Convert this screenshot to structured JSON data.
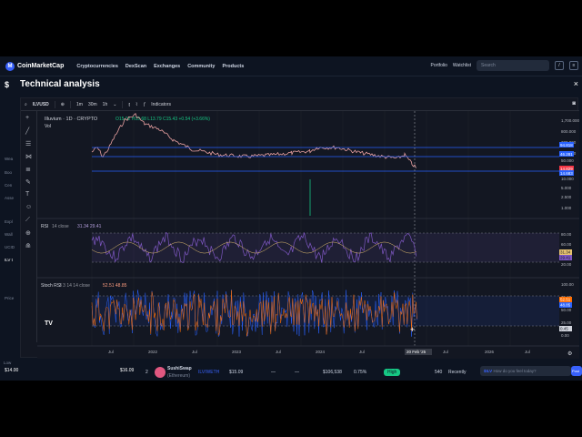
{
  "nav": {
    "brand": "CoinMarketCap",
    "links": [
      "Cryptocurrencies",
      "DexScan",
      "Exchanges",
      "Community",
      "Products"
    ],
    "portfolio": "Portfolio",
    "watchlist": "Watchlist",
    "search_placeholder": "Search",
    "slash_key": "/"
  },
  "left_fragments": {
    "dollar": "$",
    "items": [
      "Wea",
      "Boo",
      "Cen",
      "Asse",
      "Expl",
      "Wall",
      "UCID",
      "ILV t",
      "Price"
    ],
    "low_label": "Low",
    "low_value": "$14.00",
    "high_value": "$16.09"
  },
  "modal": {
    "title": "Technical analysis",
    "close": "×"
  },
  "toolbar": {
    "symbol": "ILVUSD",
    "intervals": [
      "1m",
      "30m",
      "1h"
    ],
    "indicators": "Indicators"
  },
  "legend": {
    "title": "Illuvium · 1D · CRYPTO",
    "ohlc": "O15.02 H15.68 L13.79 C15.43 +0.54 (+3.66%)",
    "vol": "Vol"
  },
  "rsi": {
    "label": "RSI",
    "params": "14 close",
    "values": "31.34 29.41"
  },
  "stoch": {
    "label": "Stoch RSI",
    "params": "3 3 14 14 close",
    "values": "52.51 48.85"
  },
  "price_axis": [
    "1,700.000",
    "800.000",
    "300.000",
    "100.000",
    "50.000",
    "20.000",
    "10.000",
    "5.000",
    "2.500",
    "1.000"
  ],
  "price_tags": [
    {
      "text": "94.818",
      "color": "#2962ff"
    },
    {
      "text": "46.281",
      "color": "#2962ff"
    },
    {
      "text": "14.829",
      "color": "#f23645"
    },
    {
      "text": "14.683",
      "color": "#2962ff"
    }
  ],
  "rsi_axis": [
    "80.00",
    "60.00",
    "40.00",
    "20.00"
  ],
  "rsi_tags": [
    "31.34",
    "29.41"
  ],
  "stoch_axis": [
    "100.00",
    "75.00",
    "50.00",
    "25.00",
    "0.00"
  ],
  "stoch_tags": [
    "52.51",
    "48.85",
    "0.45"
  ],
  "time_axis": [
    "Jul",
    "2022",
    "Jul",
    "2023",
    "Jul",
    "2024",
    "Jul",
    "20 Feb '25",
    "Jul",
    "2026",
    "Jul"
  ],
  "table_row": {
    "rank": "2",
    "exchange": "SushiSwap",
    "chain": "(Ethereum)",
    "pair": "ILV/WETH",
    "price": "$15.09",
    "dash1": "—",
    "dash2": "—",
    "volume": "$106,538",
    "pct": "0.75%",
    "confidence": "High",
    "liquidity": "540",
    "updated": "Recently"
  },
  "chat": {
    "label": "$ILV",
    "placeholder": "How do you feel today?",
    "post": "Post"
  },
  "colors": {
    "background": "#131722",
    "price_line": "#e8a0a0",
    "rsi_line": "#7e57c2",
    "stoch_k": "#2962ff",
    "stoch_d": "#ff6d00",
    "level_line": "#2962ff",
    "accent": "#3861fb",
    "positive": "#16c784"
  }
}
